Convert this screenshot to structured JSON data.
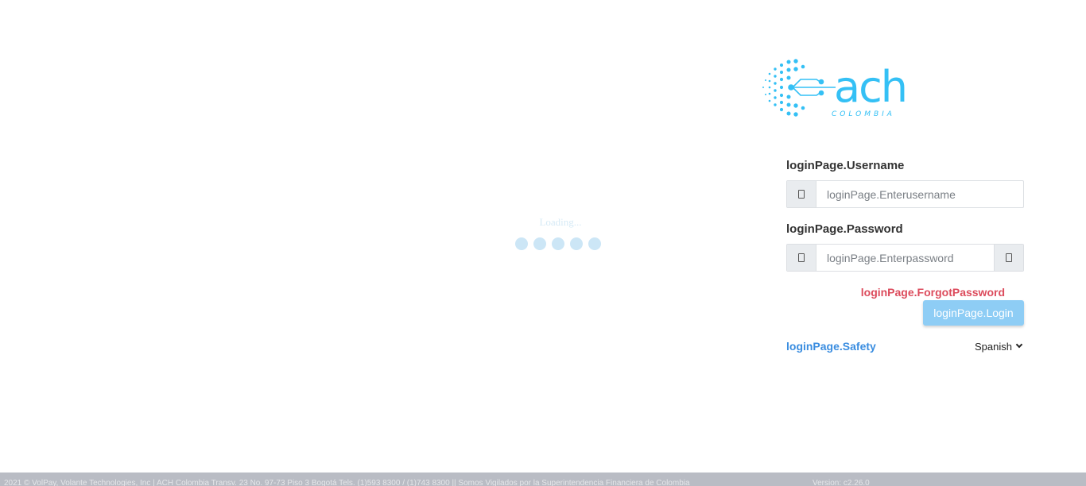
{
  "loading": {
    "text": "Loading..."
  },
  "logo": {
    "wordmark": "ach",
    "subtitle": "COLOMBIA",
    "brand_color": "#34c0f5"
  },
  "login": {
    "username_label": "loginPage.Username",
    "username_placeholder": "loginPage.Enterusername",
    "password_label": "loginPage.Password",
    "password_placeholder": "loginPage.Enterpassword",
    "forgot_password": "loginPage.ForgotPassword",
    "login_button": "loginPage.Login",
    "safety_link": "loginPage.Safety",
    "language": "Spanish"
  },
  "footer": {
    "text": "2021 © VolPay, Volante Technologies, Inc | ACH Colombia Transv. 23 No. 97-73 Piso 3 Bogotá Tels. (1)593 8300 / (1)743 8300 || Somos Vigilados por la Superintendencia Financiera de Colombia",
    "version": "Version: c2.26.0"
  },
  "colors": {
    "accent": "#8ecdf5",
    "forgot": "#dc4b5c",
    "safety": "#3a8de0",
    "footer_bg": "#b9bcc4"
  }
}
